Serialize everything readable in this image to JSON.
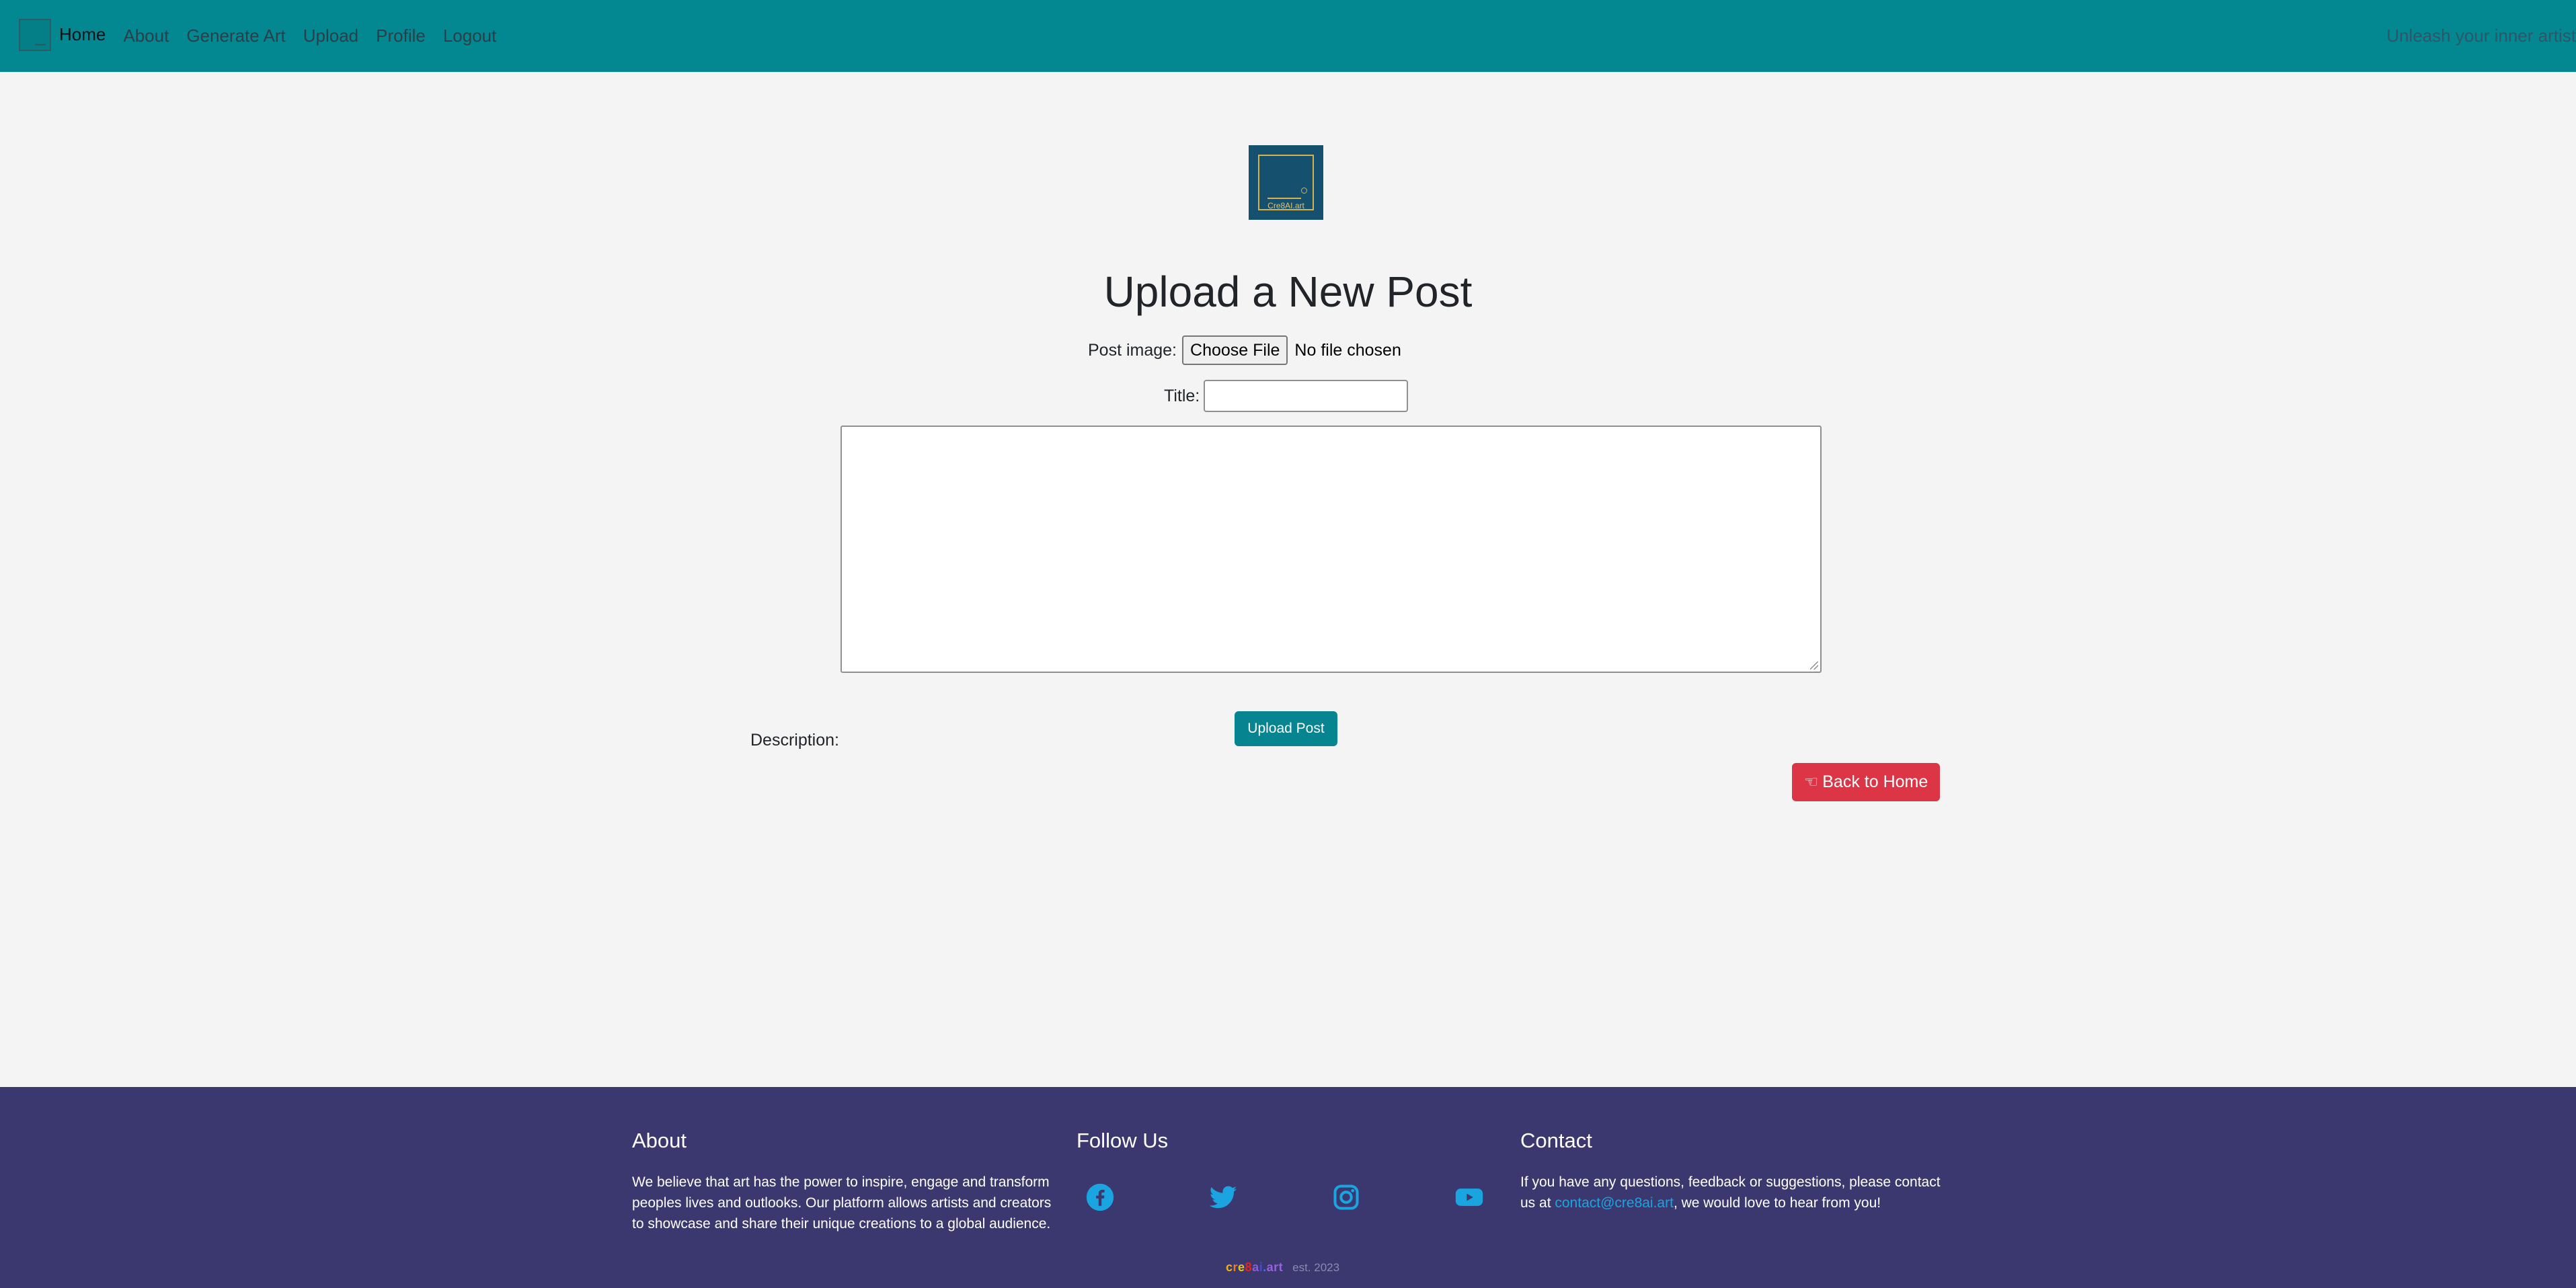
{
  "navbar": {
    "items": [
      {
        "label": "Home",
        "active": true
      },
      {
        "label": "About"
      },
      {
        "label": "Generate Art"
      },
      {
        "label": "Upload"
      },
      {
        "label": "Profile"
      },
      {
        "label": "Logout"
      }
    ],
    "tagline": "Unleash your inner artist",
    "color": "#038891"
  },
  "logo": {
    "text": "Cre8AI.art"
  },
  "main": {
    "title": "Upload a New Post",
    "post_image_label": "Post image:",
    "choose_file_label": "Choose File",
    "file_status": "No file chosen",
    "title_label": "Title:",
    "title_value": "",
    "description_label": "Description:",
    "description_value": "",
    "upload_button": "Upload Post",
    "back_button": "Back to Home",
    "back_icon": "pointing-hand-icon"
  },
  "footer": {
    "about_heading": "About",
    "about_text": "We believe that art has the power to inspire, engage and transform peoples lives and outlooks. Our platform allows artists and creators to showcase and share their unique creations to a global audience.",
    "follow_heading": "Follow Us",
    "social": [
      "facebook-icon",
      "twitter-icon",
      "instagram-icon",
      "youtube-icon"
    ],
    "contact_heading": "Contact",
    "contact_text_before": "If you have any questions, feedback or suggestions, please contact us at ",
    "contact_email": "contact@cre8ai.art",
    "contact_text_after": ", we would love to hear from you!",
    "brand": "cre8ai.art",
    "est": "est. 2023",
    "color": "#3b3870"
  }
}
